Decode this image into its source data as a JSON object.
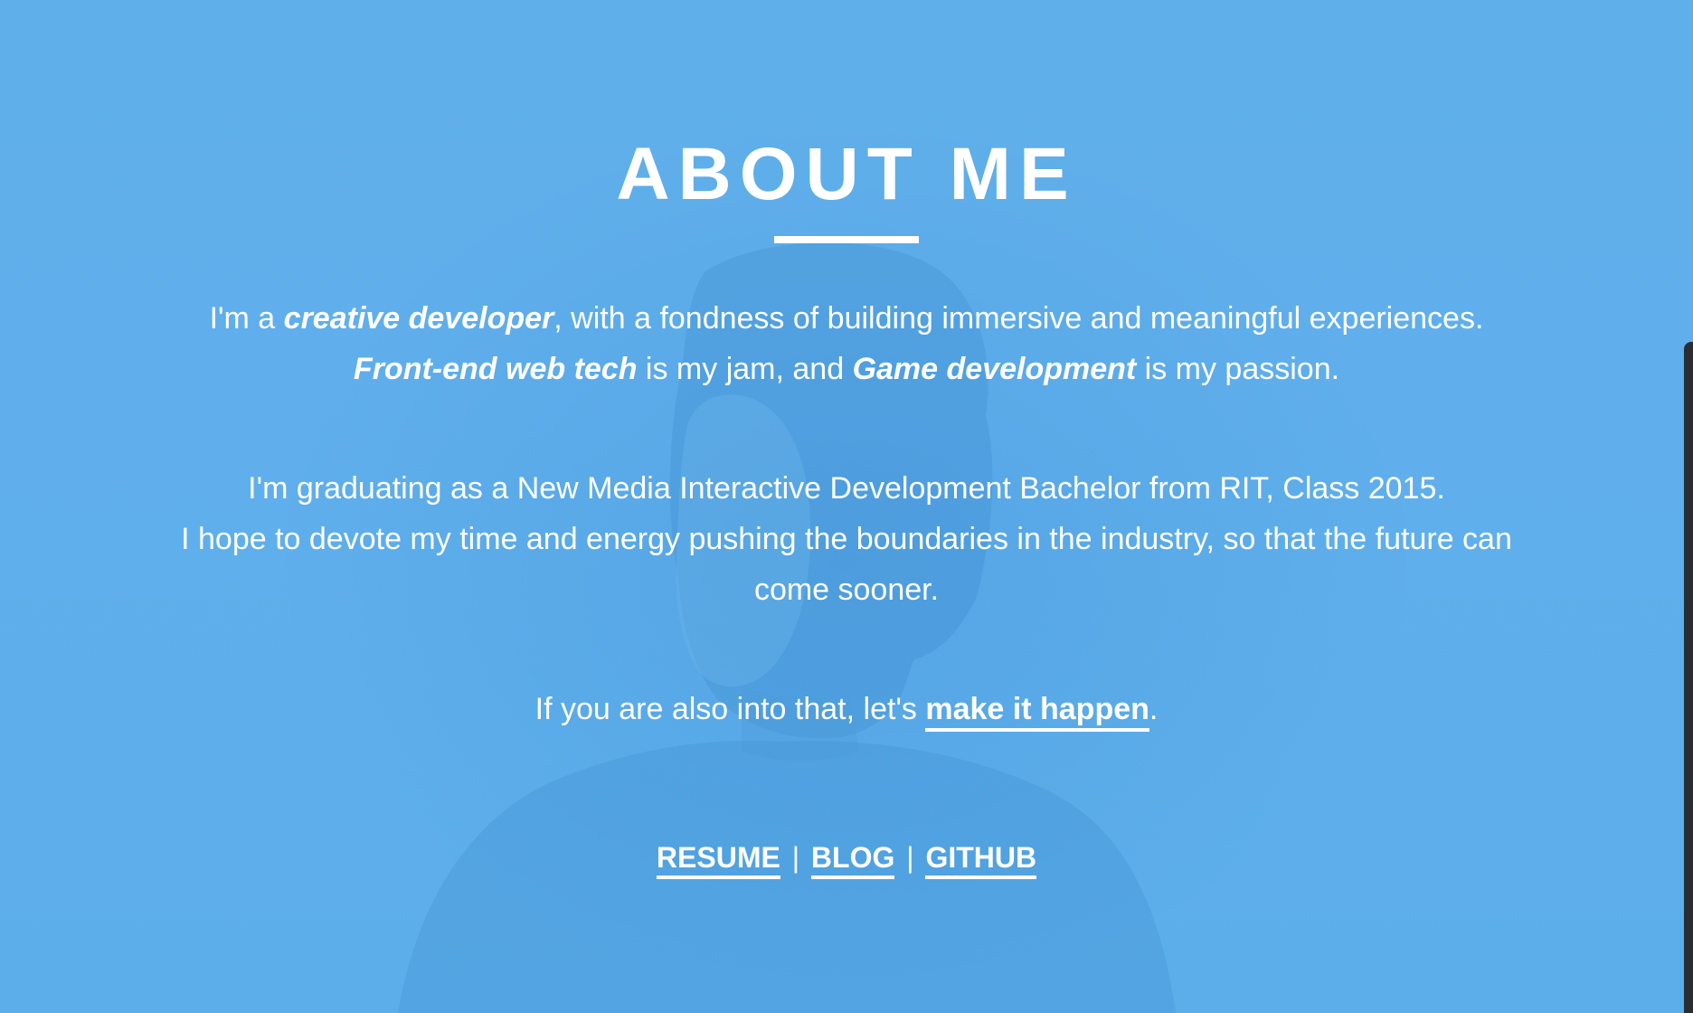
{
  "section": {
    "title": "ABOUT ME"
  },
  "intro": {
    "p1_prefix": "I'm a ",
    "p1_emph": "creative developer",
    "p1_suffix": ", with a fondness of building immersive and meaningful experiences.",
    "p1_emph2": "Front-end web tech",
    "p1_mid": " is my jam, and ",
    "p1_emph3": "Game development",
    "p1_end": " is my passion."
  },
  "education": {
    "line1": "I'm graduating as a New Media Interactive Development Bachelor from RIT, Class 2015.",
    "line2": "I hope to devote my time and energy pushing the boundaries in the industry, so that the future can come sooner."
  },
  "cta": {
    "prefix": "If you are also into that, let's ",
    "link_label": "make it happen",
    "suffix": "."
  },
  "footer_links": {
    "resume": "RESUME",
    "separator1": "|",
    "blog": "BLOG",
    "separator2": "|",
    "github": "GITHUB"
  },
  "colors": {
    "background": "#5eaeea",
    "text": "#ffffff",
    "scrollbar": "#2a2d33"
  }
}
